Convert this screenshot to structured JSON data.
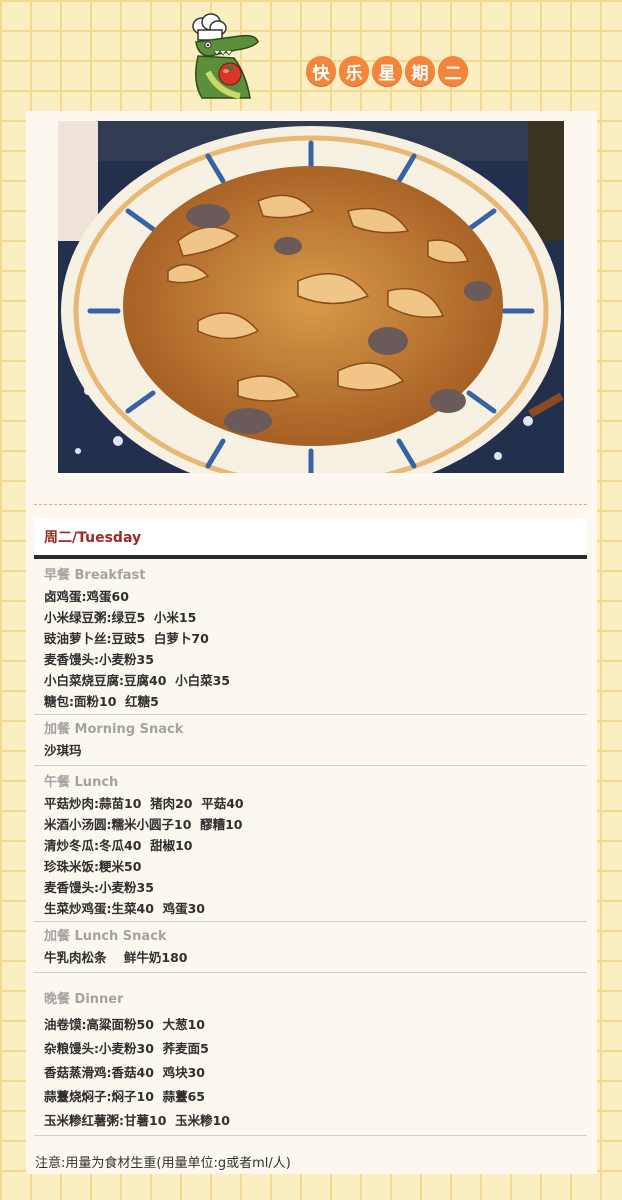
{
  "header": {
    "title_chars": [
      "快",
      "乐",
      "星",
      "期",
      "二"
    ]
  },
  "menu": {
    "day_title": "周二/Tuesday",
    "sections": [
      {
        "label": "早餐 Breakfast",
        "items": [
          "卤鸡蛋:鸡蛋60",
          "小米绿豆粥:绿豆5  小米15",
          "豉油萝卜丝:豆豉5  白萝卜70",
          "麦香馒头:小麦粉35",
          "小白菜烧豆腐:豆腐40  小白菜35",
          "糖包:面粉10  红糖5"
        ]
      },
      {
        "label": "加餐 Morning Snack",
        "items": [
          "沙琪玛"
        ]
      },
      {
        "label": "午餐 Lunch",
        "items": [
          "平菇炒肉:蒜苗10  猪肉20  平菇40",
          "米酒小汤圆:糯米小圆子10  醪糟10",
          "清炒冬瓜:冬瓜40  甜椒10",
          "珍珠米饭:粳米50",
          "麦香馒头:小麦粉35",
          "生菜炒鸡蛋:生菜40  鸡蛋30"
        ]
      },
      {
        "label": "加餐 Lunch Snack",
        "items": [
          "牛乳肉松条    鲜牛奶180"
        ]
      },
      {
        "label": "晚餐 Dinner",
        "items": [
          "油卷馍:高粱面粉50  大葱10",
          "杂粮馒头:小麦粉30  荞麦面5",
          "香菇蒸滑鸡:香菇40  鸡块30",
          "蒜薹烧焖子:焖子10  蒜薹65",
          "玉米糁红薯粥:甘薯10  玉米糁10"
        ]
      }
    ]
  },
  "footer": {
    "note": "注意:用量为食材生重(用量单位:g或者ml/人)"
  },
  "colors": {
    "background": "#fbeec2",
    "grid": "#f3d98e",
    "title_circle": "#f3863a",
    "day_title": "#9b2b22"
  },
  "icons": {
    "mascot": "crocodile-chef-icon"
  }
}
